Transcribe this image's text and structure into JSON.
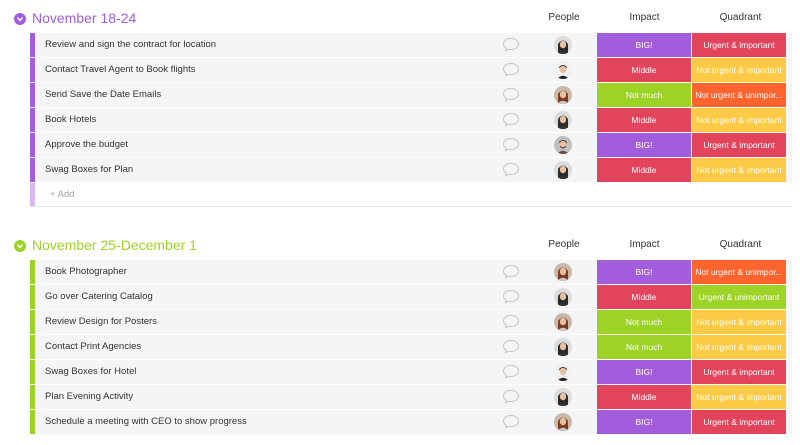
{
  "columns": {
    "people": "People",
    "impact": "Impact",
    "quadrant": "Quadrant"
  },
  "status_colors": {
    "BIG!": "#a25ddc",
    "Middle": "#e2445c",
    "Not much": "#9cd326",
    "Urgent & important": "#e2445c",
    "Not urgent & important": "#fdca48",
    "Not urgent & unimportant": "#ff642e",
    "Urgent & unimportant": "#9cd326"
  },
  "groups": [
    {
      "title": "November 18-24",
      "color": "#a25ddc",
      "add_label": "+ Add",
      "rows": [
        {
          "name": "Review and sign the contract for location",
          "impact": "BIG!",
          "quadrant": "Urgent & important",
          "avatar": "woman-dark-hair"
        },
        {
          "name": "Contact Travel Agent to Book flights",
          "impact": "Middle",
          "quadrant": "Not urgent & important",
          "avatar": "man-dark-hair"
        },
        {
          "name": "Send Save the Date Emails",
          "impact": "Not much",
          "quadrant": "Not urgent & unimpor...",
          "avatar": "woman-brown-hair"
        },
        {
          "name": "Book Hotels",
          "impact": "Middle",
          "quadrant": "Not urgent & important",
          "avatar": "woman-dark-hair"
        },
        {
          "name": "Approve the budget",
          "impact": "BIG!",
          "quadrant": "Urgent & important",
          "avatar": "man-beard"
        },
        {
          "name": "Swag Boxes for Plan",
          "impact": "Middle",
          "quadrant": "Not urgent & important",
          "avatar": "woman-dark-hair"
        }
      ]
    },
    {
      "title": "November 25-December 1",
      "color": "#9cd326",
      "rows": [
        {
          "name": "Book Photographer",
          "impact": "BIG!",
          "quadrant": "Not urgent & unimpor...",
          "avatar": "woman-brown-hair"
        },
        {
          "name": "Go over Catering Catalog",
          "impact": "Middle",
          "quadrant": "Urgent & unimportant",
          "avatar": "woman-dark-hair"
        },
        {
          "name": "Review Design for Posters",
          "impact": "Not much",
          "quadrant": "Not urgent & important",
          "avatar": "woman-brown-hair"
        },
        {
          "name": "Contact Print Agencies",
          "impact": "Not much",
          "quadrant": "Not urgent & important",
          "avatar": "woman-dark-hair"
        },
        {
          "name": "Swag Boxes for Hotel",
          "impact": "BIG!",
          "quadrant": "Urgent & important",
          "avatar": "man-dark-hair"
        },
        {
          "name": "Plan Evening Activity",
          "impact": "Middle",
          "quadrant": "Not urgent & important",
          "avatar": "woman-dark-hair"
        },
        {
          "name": "Schedule a meeting with CEO to show progress",
          "impact": "BIG!",
          "quadrant": "Urgent & important",
          "avatar": "woman-brown-hair"
        }
      ]
    }
  ]
}
